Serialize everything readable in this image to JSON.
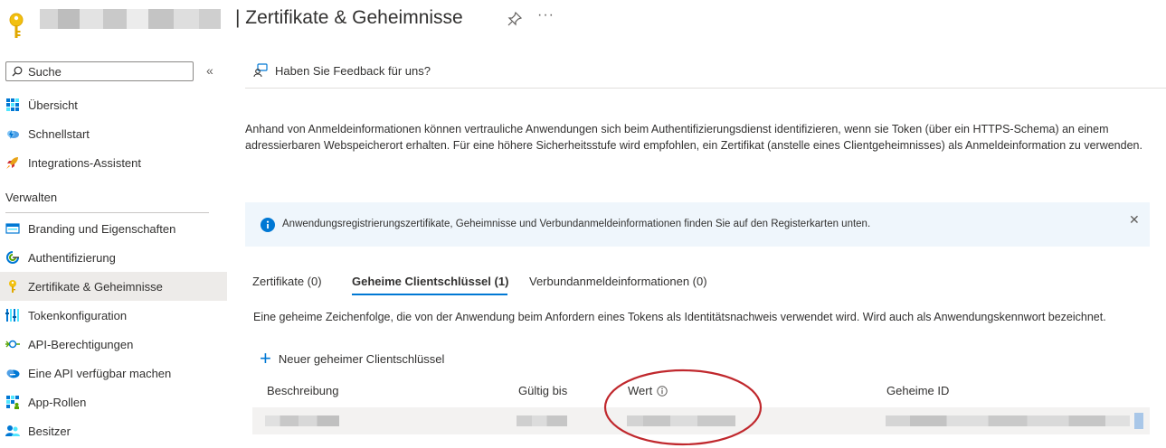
{
  "header": {
    "title": "| Zertifikate & Geheimnisse",
    "more": "···"
  },
  "sidebar": {
    "search_placeholder": "Suche",
    "collapse": "«",
    "items": [
      {
        "label": "Übersicht",
        "icon": "grid-icon"
      },
      {
        "label": "Schnellstart",
        "icon": "cloud-lightning-icon"
      },
      {
        "label": "Integrations-Assistent",
        "icon": "rocket-icon"
      }
    ],
    "group_label": "Verwalten",
    "manage_items": [
      {
        "label": "Branding und Eigenschaften",
        "icon": "branding-icon"
      },
      {
        "label": "Authentifizierung",
        "icon": "authentication-icon"
      },
      {
        "label": "Zertifikate & Geheimnisse",
        "icon": "key-icon",
        "active": true
      },
      {
        "label": "Tokenkonfiguration",
        "icon": "token-bars-icon"
      },
      {
        "label": "API-Berechtigungen",
        "icon": "api-permissions-icon"
      },
      {
        "label": "Eine API verfügbar machen",
        "icon": "cloud-api-icon"
      },
      {
        "label": "App-Rollen",
        "icon": "app-roles-icon"
      },
      {
        "label": "Besitzer",
        "icon": "owners-icon"
      }
    ]
  },
  "main": {
    "feedback": "Haben Sie Feedback für uns?",
    "description": "Anhand von Anmeldeinformationen können vertrauliche Anwendungen sich beim Authentifizierungsdienst identifizieren, wenn sie Token (über ein HTTPS-Schema) an einem adressierbaren Webspeicherort erhalten. Für eine höhere Sicherheitsstufe wird empfohlen, ein Zertifikat (anstelle eines Clientgeheimnisses) als Anmeldeinformation zu verwenden.",
    "info": "Anwendungsregistrierungszertifikate, Geheimnisse und Verbundanmeldeinformationen finden Sie auf den Registerkarten unten.",
    "info_close": "✕",
    "tabs": [
      {
        "label": "Zertifikate (0)"
      },
      {
        "label": "Geheime Clientschlüssel (1)",
        "active": true
      },
      {
        "label": "Verbundanmeldeinformationen (0)"
      }
    ],
    "tab_description": "Eine geheime Zeichenfolge, die von der Anwendung beim Anfordern eines Tokens als Identitätsnachweis verwendet wird. Wird auch als Anwendungskennwort bezeichnet.",
    "new_secret": "Neuer geheimer Clientschlüssel",
    "columns": [
      "Beschreibung",
      "Gültig bis",
      "Wert",
      "Geheime ID"
    ],
    "colors": {
      "accent": "#0078d4",
      "highlight_ellipse": "#c0282d",
      "info_bg": "#eff6fc"
    }
  }
}
